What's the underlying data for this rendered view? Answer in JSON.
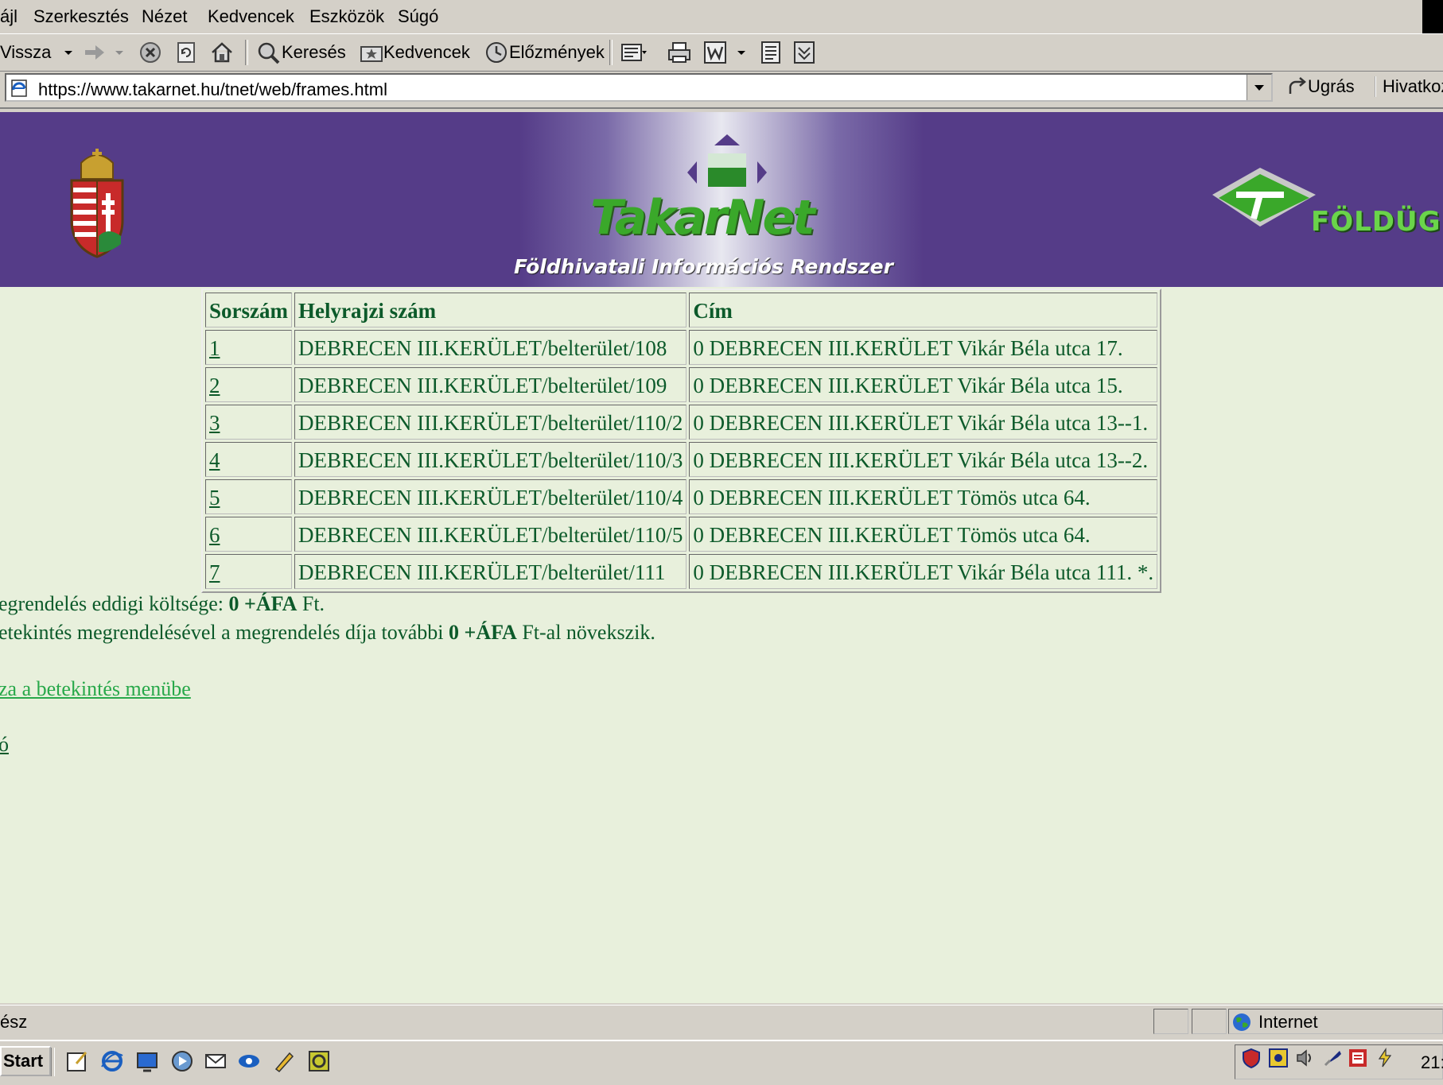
{
  "menu": {
    "items": [
      "ájl",
      "Szerkesztés",
      "Nézet",
      "Kedvencek",
      "Eszközök",
      "Súgó"
    ]
  },
  "toolbar": {
    "back_label": "Vissza",
    "search_label": "Keresés",
    "favorites_label": "Kedvencek",
    "history_label": "Előzmények"
  },
  "address": {
    "url": "https://www.takarnet.hu/tnet/web/frames.html",
    "go_label": "Ugrás",
    "links_label": "Hivatkoz"
  },
  "banner": {
    "brand": "TakarNet",
    "subtitle": "Földhivatali Információs Rendszer",
    "right_brand": "FÖLDÜG"
  },
  "table": {
    "headers": [
      "Sorszám",
      "Helyrajzi szám",
      "Cím"
    ],
    "rows": [
      {
        "num": "1",
        "hrsz": "DEBRECEN III.KERÜLET/belterület/108",
        "cim": "0 DEBRECEN III.KERÜLET Vikár Béla utca 17."
      },
      {
        "num": "2",
        "hrsz": "DEBRECEN III.KERÜLET/belterület/109",
        "cim": "0 DEBRECEN III.KERÜLET Vikár Béla utca 15."
      },
      {
        "num": "3",
        "hrsz": "DEBRECEN III.KERÜLET/belterület/110/2",
        "cim": "0 DEBRECEN III.KERÜLET Vikár Béla utca 13--1."
      },
      {
        "num": "4",
        "hrsz": "DEBRECEN III.KERÜLET/belterület/110/3",
        "cim": "0 DEBRECEN III.KERÜLET Vikár Béla utca 13--2."
      },
      {
        "num": "5",
        "hrsz": "DEBRECEN III.KERÜLET/belterület/110/4",
        "cim": "0 DEBRECEN III.KERÜLET Tömös utca 64."
      },
      {
        "num": "6",
        "hrsz": "DEBRECEN III.KERÜLET/belterület/110/5",
        "cim": "0 DEBRECEN III.KERÜLET Tömös utca 64."
      },
      {
        "num": "7",
        "hrsz": "DEBRECEN III.KERÜLET/belterület/111",
        "cim": "0 DEBRECEN III.KERÜLET Vikár Béla utca 111. *."
      }
    ]
  },
  "info": {
    "cost_prefix": "egrendelés eddigi költsége: ",
    "cost_value": "0 +ÁFA",
    "cost_suffix": " Ft.",
    "extra_prefix": "etekintés megrendelésével a megrendelés díja további ",
    "extra_value": "0 +ÁFA",
    "extra_suffix": " Ft-al növekszik."
  },
  "links": {
    "back_menu": "za a betekintés menübe",
    "other": "ó"
  },
  "status": {
    "text": "ész",
    "zone": "Internet"
  },
  "taskbar": {
    "start_label": "Start",
    "clock": "21:"
  },
  "colors": {
    "page_bg": "#e8f0dc",
    "text_green": "#0c5a2a",
    "link_green": "#28a84a",
    "banner_purple": "#553c88"
  }
}
